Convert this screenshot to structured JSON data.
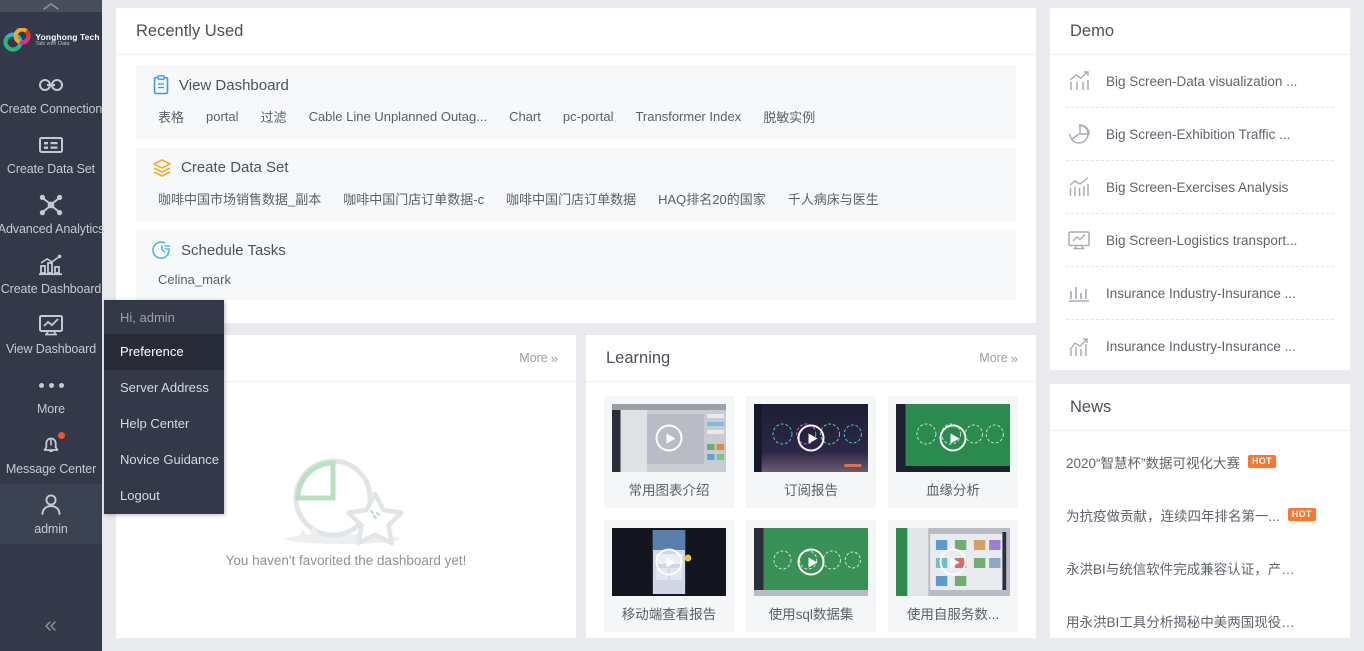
{
  "sidebar": {
    "logo": {
      "name": "Yonghong Tech",
      "tagline": "Talk with Data"
    },
    "collapse_top_icon": "chevron-up-icon",
    "collapse_bottom_icon": "double-chevron-left-icon",
    "items": [
      {
        "label": "Create Connection",
        "icon": "link-icon"
      },
      {
        "label": "Create Data Set",
        "icon": "dataset-icon"
      },
      {
        "label": "Advanced Analytics",
        "icon": "analytics-node-icon"
      },
      {
        "label": "Create Dashboard",
        "icon": "bar-chart-icon"
      },
      {
        "label": "View Dashboard",
        "icon": "monitor-chart-icon"
      },
      {
        "label": "More",
        "icon": "ellipsis-icon"
      },
      {
        "label": "Message Center",
        "icon": "bell-icon",
        "badge": true
      },
      {
        "label": "admin",
        "icon": "user-icon",
        "active": true
      }
    ]
  },
  "user_menu": {
    "greeting": "Hi, admin",
    "items": [
      {
        "label": "Preference",
        "selected": true
      },
      {
        "label": "Server Address",
        "selected": false
      },
      {
        "label": "Help Center",
        "selected": false
      },
      {
        "label": "Novice Guidance",
        "selected": false
      },
      {
        "label": "Logout",
        "selected": false
      }
    ]
  },
  "recently_used": {
    "title": "Recently Used",
    "groups": [
      {
        "name": "View Dashboard",
        "icon": "dashboard-doc-icon",
        "items": [
          "表格",
          "portal",
          "过滤",
          "Cable Line Unplanned Outag...",
          "Chart",
          "pc-portal",
          "Transformer Index",
          "脱敏实例"
        ]
      },
      {
        "name": "Create Data Set",
        "icon": "layers-icon",
        "items": [
          "咖啡中国市场销售数据_副本",
          "咖啡中国门店订单数据-c",
          "咖啡中国门店订单数据",
          "HAQ排名20的国家",
          "千人病床与医生"
        ]
      },
      {
        "name": "Schedule Tasks",
        "icon": "clock-task-icon",
        "items": [
          "Celina_mark"
        ]
      }
    ]
  },
  "favorites": {
    "more_label": "More",
    "empty_message": "You haven't favorited the dashboard yet!"
  },
  "learning": {
    "title": "Learning",
    "more_label": "More",
    "cards": [
      {
        "caption": "常用图表介绍",
        "thumb": "light-ui"
      },
      {
        "caption": "订阅报告",
        "thumb": "dark-purple"
      },
      {
        "caption": "血缘分析",
        "thumb": "green"
      },
      {
        "caption": "移动端查看报告",
        "thumb": "mobile-dark"
      },
      {
        "caption": "使用sql数据集",
        "thumb": "green2"
      },
      {
        "caption": "使用自服务数...",
        "thumb": "gray-ui"
      }
    ]
  },
  "demo": {
    "title": "Demo",
    "items": [
      {
        "label": "Big Screen-Data visualization ...",
        "icon": "bar-trend-icon"
      },
      {
        "label": "Big Screen-Exhibition Traffic ...",
        "icon": "pie-chart-icon"
      },
      {
        "label": "Big Screen-Exercises Analysis",
        "icon": "column-line-icon"
      },
      {
        "label": "Big Screen-Logistics transport...",
        "icon": "monitor-chart-icon"
      },
      {
        "label": "Insurance Industry-Insurance ...",
        "icon": "histogram-icon"
      },
      {
        "label": "Insurance Industry-Insurance ...",
        "icon": "trend-arrow-icon"
      }
    ]
  },
  "news": {
    "title": "News",
    "items": [
      {
        "text": "2020“智慧杯”数据可视化大赛",
        "badge": "HOT"
      },
      {
        "text": "为抗疫做贡献，连续四年排名第一...",
        "badge": "HOT"
      },
      {
        "text": "永洪BI与统信软件完成兼容认证，产业...",
        "badge": ""
      },
      {
        "text": " 用永洪BI工具分析揭秘中美两国现役武器",
        "badge": ""
      }
    ]
  },
  "colors": {
    "sidebar_bg": "#333948",
    "menu_selected": "#272c38",
    "page_bg": "#e9eaee",
    "accent_orange": "#f7782c",
    "badge_red": "#f4542c"
  }
}
